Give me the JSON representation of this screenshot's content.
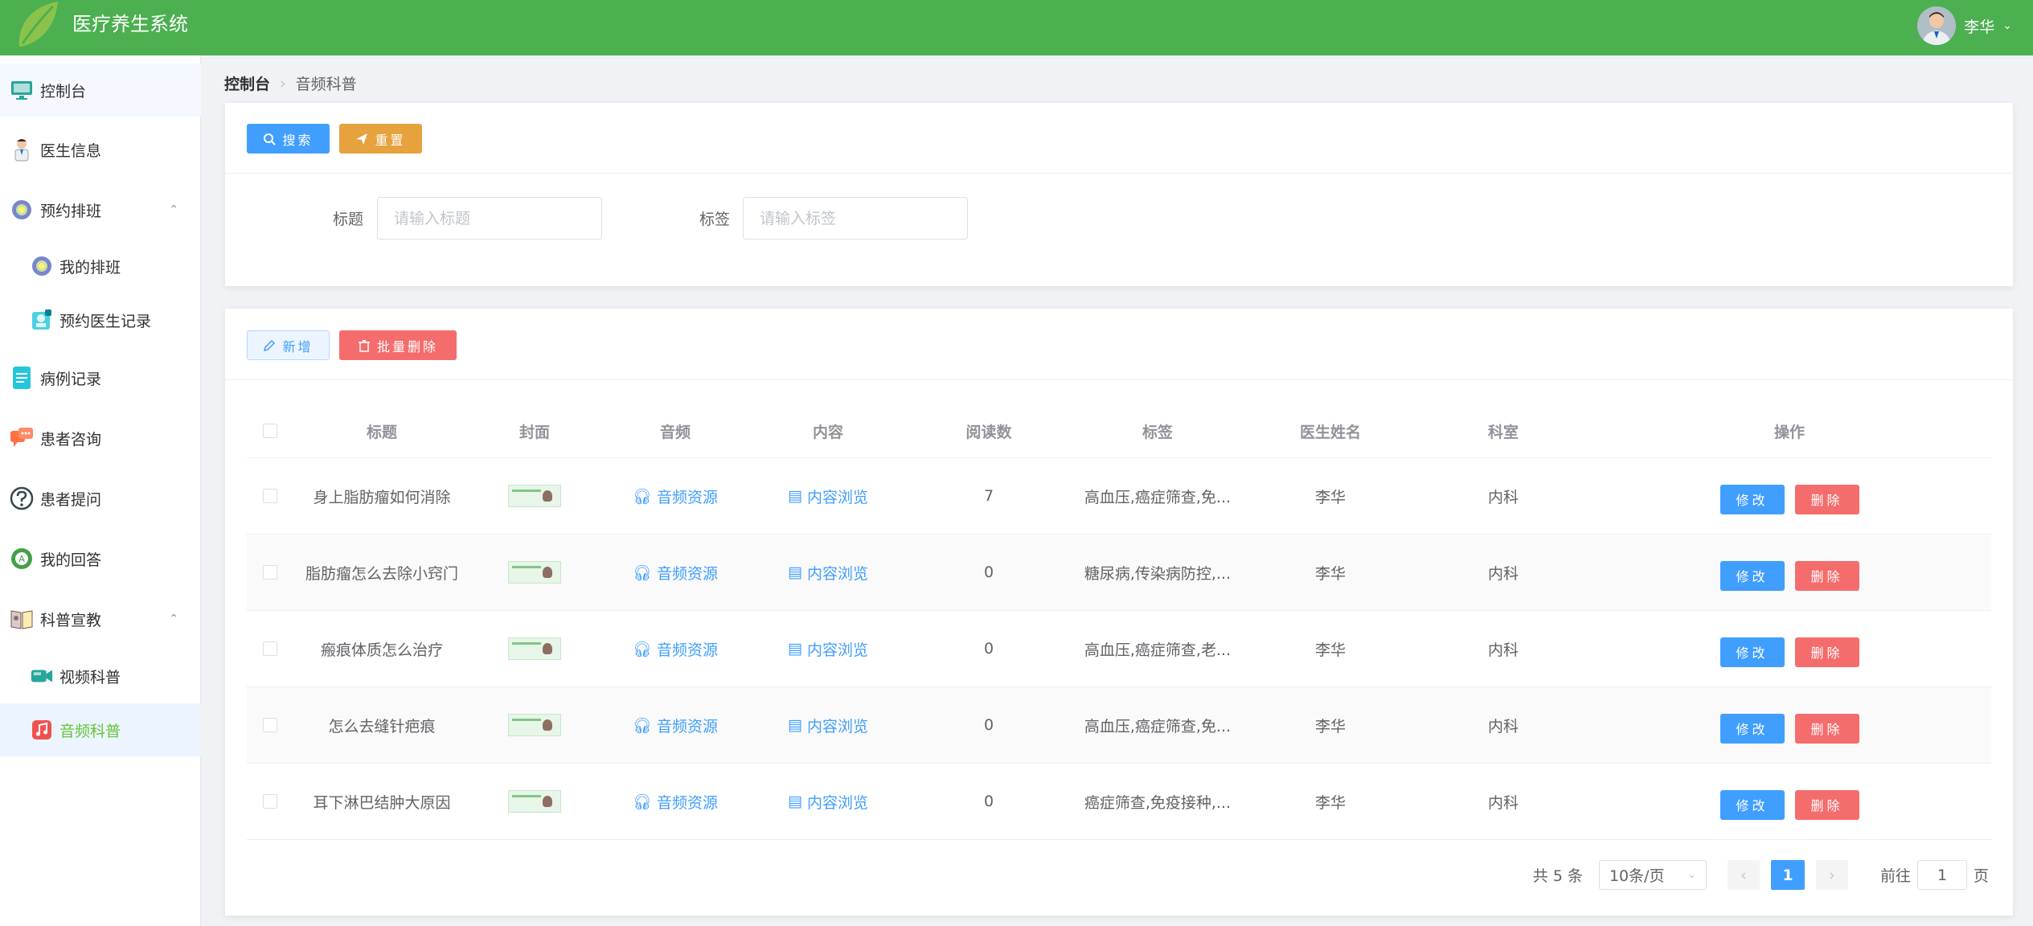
{
  "header": {
    "title": "医疗养生系统",
    "user_name": "李华"
  },
  "sidebar": {
    "items": [
      {
        "label": "控制台"
      },
      {
        "label": "医生信息"
      },
      {
        "label": "预约排班"
      },
      {
        "label": "我的排班"
      },
      {
        "label": "预约医生记录"
      },
      {
        "label": "病例记录"
      },
      {
        "label": "患者咨询"
      },
      {
        "label": "患者提问"
      },
      {
        "label": "我的回答"
      },
      {
        "label": "科普宣教"
      },
      {
        "label": "视频科普"
      },
      {
        "label": "音频科普"
      }
    ]
  },
  "breadcrumb": {
    "root": "控制台",
    "current": "音频科普"
  },
  "search": {
    "search_label": "搜索",
    "reset_label": "重置",
    "title_label": "标题",
    "title_placeholder": "请输入标题",
    "tag_label": "标签",
    "tag_placeholder": "请输入标签"
  },
  "toolbar": {
    "add_label": "新增",
    "batch_delete_label": "批量删除"
  },
  "table": {
    "headers": {
      "title": "标题",
      "cover": "封面",
      "audio": "音频",
      "content": "内容",
      "reads": "阅读数",
      "tags": "标签",
      "doctor": "医生姓名",
      "dept": "科室",
      "ops": "操作"
    },
    "rows": [
      {
        "title": "身上脂肪瘤如何消除",
        "audio": "音频资源",
        "content": "内容浏览",
        "reads": "7",
        "tags": "高血压,癌症筛查,免...",
        "doctor": "李华",
        "dept": "内科",
        "edit": "修改",
        "delete": "删除"
      },
      {
        "title": "脂肪瘤怎么去除小窍门",
        "audio": "音频资源",
        "content": "内容浏览",
        "reads": "0",
        "tags": "糖尿病,传染病防控,...",
        "doctor": "李华",
        "dept": "内科",
        "edit": "修改",
        "delete": "删除"
      },
      {
        "title": "瘢痕体质怎么治疗",
        "audio": "音频资源",
        "content": "内容浏览",
        "reads": "0",
        "tags": "高血压,癌症筛查,老...",
        "doctor": "李华",
        "dept": "内科",
        "edit": "修改",
        "delete": "删除"
      },
      {
        "title": "怎么去缝针疤痕",
        "audio": "音频资源",
        "content": "内容浏览",
        "reads": "0",
        "tags": "高血压,癌症筛查,免...",
        "doctor": "李华",
        "dept": "内科",
        "edit": "修改",
        "delete": "删除"
      },
      {
        "title": "耳下淋巴结肿大原因",
        "audio": "音频资源",
        "content": "内容浏览",
        "reads": "0",
        "tags": "癌症筛查,免疫接种,...",
        "doctor": "李华",
        "dept": "内科",
        "edit": "修改",
        "delete": "删除"
      }
    ]
  },
  "pagination": {
    "total": "共 5 条",
    "page_size": "10条/页",
    "current": "1",
    "goto_prefix": "前往",
    "goto_value": "1",
    "goto_suffix": "页"
  },
  "colors": {
    "header": "#4caf50",
    "primary": "#409eff",
    "warning": "#e6a23c",
    "danger": "#f56c6c"
  }
}
